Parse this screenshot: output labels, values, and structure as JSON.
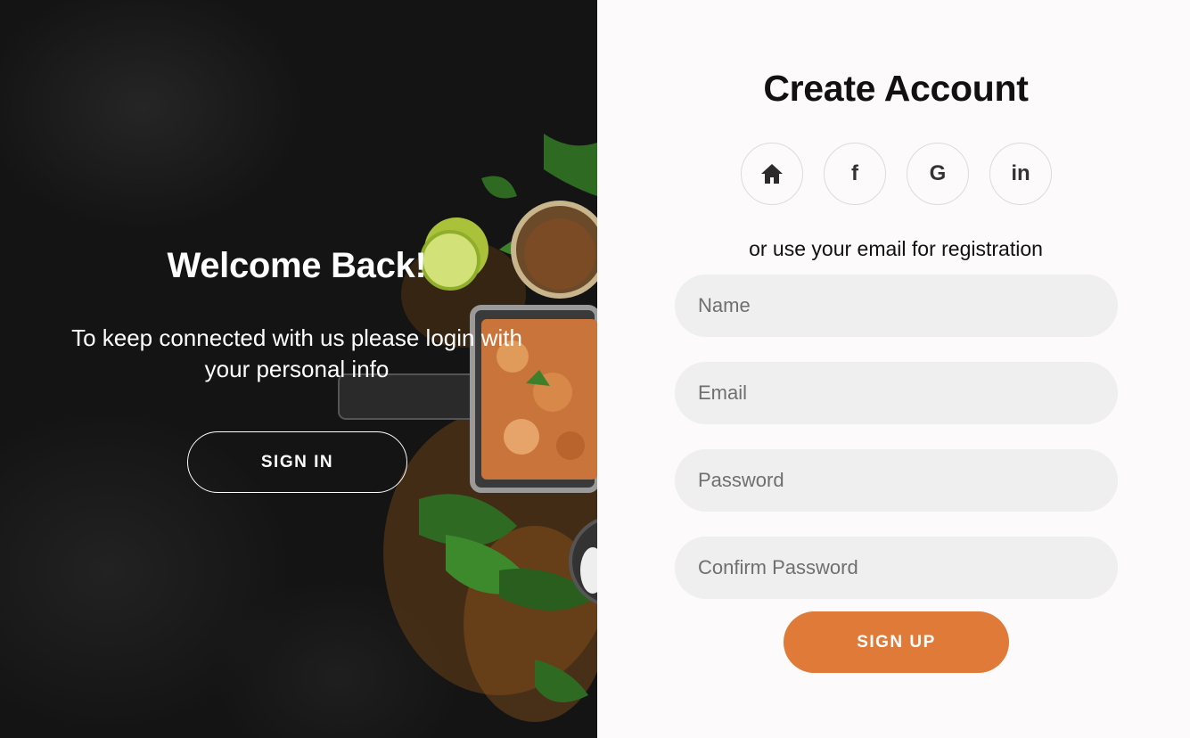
{
  "overlay": {
    "title": "Welcome Back!",
    "message": "To keep connected with us please login with your personal info",
    "signin_label": "SIGN IN"
  },
  "form": {
    "title": "Create Account",
    "social": [
      {
        "name": "home",
        "icon": "home-icon"
      },
      {
        "name": "facebook",
        "icon": "facebook-icon",
        "glyph": "f"
      },
      {
        "name": "google",
        "icon": "google-icon",
        "glyph": "G"
      },
      {
        "name": "linkedin",
        "icon": "linkedin-icon",
        "glyph": "in"
      }
    ],
    "register_text": "or use your email for registration",
    "fields": {
      "name": {
        "placeholder": "Name",
        "value": ""
      },
      "email": {
        "placeholder": "Email",
        "value": ""
      },
      "password": {
        "placeholder": "Password",
        "value": ""
      },
      "confirm_password": {
        "placeholder": "Confirm Password",
        "value": ""
      }
    },
    "signup_label": "SIGN UP"
  },
  "colors": {
    "accent": "#e07a38",
    "overlay_bg": "#141414",
    "form_bg": "#fcfafa",
    "input_bg": "#efefef"
  }
}
